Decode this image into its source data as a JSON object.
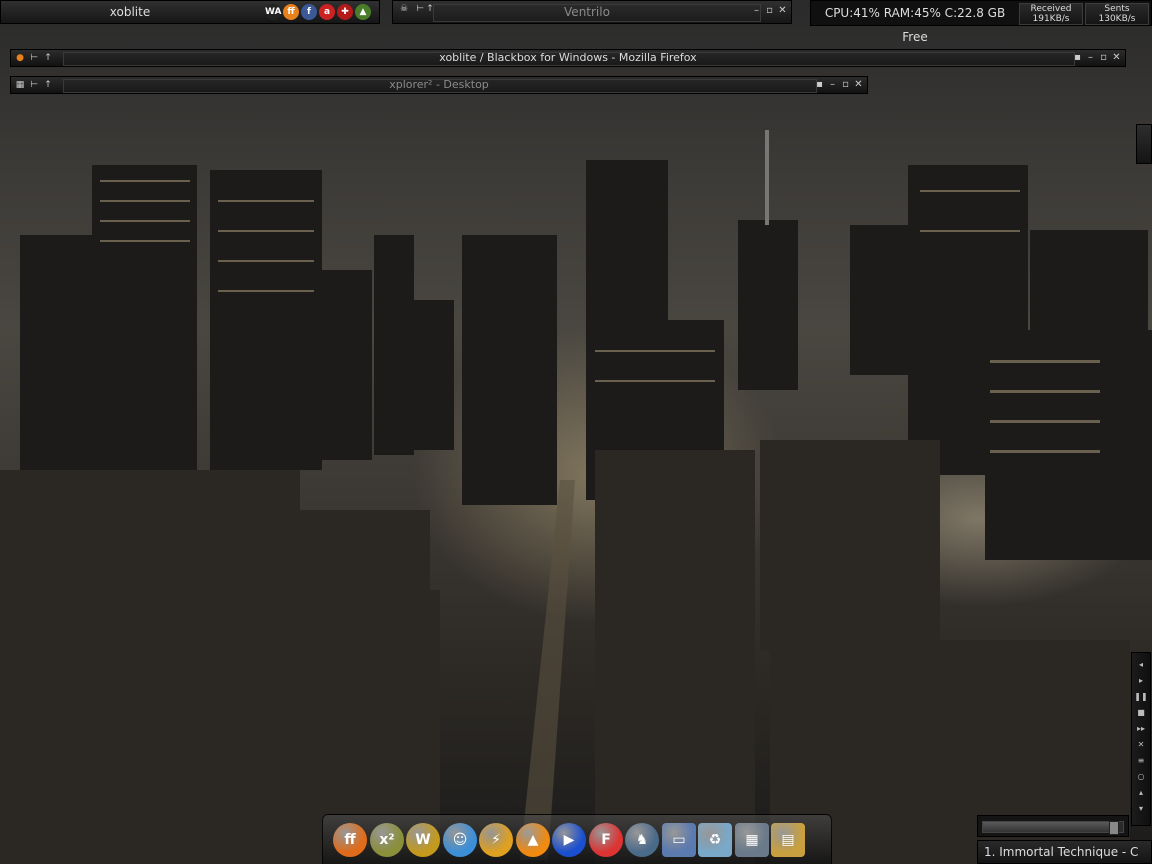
{
  "topbar": {
    "workspace_title": "xoblite",
    "tray_icons": [
      {
        "icon": "winamp-icon",
        "glyph": "WA",
        "color": "#222"
      },
      {
        "icon": "firefox-tray-icon",
        "glyph": "ff",
        "color": "#e8801c"
      },
      {
        "icon": "facebook-icon",
        "glyph": "f",
        "color": "#3b5998"
      },
      {
        "icon": "aim-icon",
        "glyph": "a",
        "color": "#c22"
      },
      {
        "icon": "shield-icon",
        "glyph": "✚",
        "color": "#b31b1b"
      },
      {
        "icon": "network-icon",
        "glyph": "▲",
        "color": "#4a7d2a"
      }
    ],
    "ventrilo_title": "Ventrilo",
    "system_stats": "CPU:41% RAM:45% C:22.8 GB Free",
    "received_label": "Received",
    "received_value": "191KB/s",
    "sent_label": "Sents",
    "sent_value": "130KB/s"
  },
  "windows": {
    "firefox_title": "xoblite / Blackbox for Windows - Mozilla Firefox",
    "xplorer_title": "xplorer² - Desktop"
  },
  "media": {
    "buttons": [
      {
        "icon": "previous-icon",
        "glyph": "◂"
      },
      {
        "icon": "play-icon",
        "glyph": "▸"
      },
      {
        "icon": "pause-icon",
        "glyph": "❚❚"
      },
      {
        "icon": "stop-icon",
        "glyph": "■"
      },
      {
        "icon": "next-icon",
        "glyph": "▸▸"
      },
      {
        "icon": "shuffle-icon",
        "glyph": "✕"
      },
      {
        "icon": "playlist-icon",
        "glyph": "≡"
      },
      {
        "icon": "repeat-icon",
        "glyph": "○"
      },
      {
        "icon": "volume-up-icon",
        "glyph": "▴"
      },
      {
        "icon": "volume-down-icon",
        "glyph": "▾"
      }
    ],
    "seek_fraction": 0.93,
    "now_playing": "1. Immortal Technique - C"
  },
  "dock": {
    "items": [
      {
        "name": "dock-firefox",
        "icon": "firefox-icon",
        "glyph": "ff",
        "color": "#e06b1a"
      },
      {
        "name": "dock-xplorer",
        "icon": "xplorer-icon",
        "glyph": "x²",
        "color": "#8a8f3a"
      },
      {
        "name": "dock-warcraft",
        "icon": "warcraft-icon",
        "glyph": "W",
        "color": "#c49a1c"
      },
      {
        "name": "dock-messenger",
        "icon": "messenger-icon",
        "glyph": "☺",
        "color": "#3b8fd8"
      },
      {
        "name": "dock-winamp",
        "icon": "winamp-dock-icon",
        "glyph": "⚡",
        "color": "#e0a020"
      },
      {
        "name": "dock-vlc",
        "icon": "vlc-icon",
        "glyph": "▲",
        "color": "#f08a10"
      },
      {
        "name": "dock-mediaplayer",
        "icon": "media-player-icon",
        "glyph": "▶",
        "color": "#1a4fd0"
      },
      {
        "name": "dock-filezilla",
        "icon": "filezilla-icon",
        "glyph": "F",
        "color": "#d33"
      },
      {
        "name": "dock-counterstrike",
        "icon": "counter-strike-icon",
        "glyph": "♞",
        "color": "#4a6a8a"
      },
      {
        "name": "dock-folder",
        "icon": "folder-icon",
        "glyph": "▭",
        "color": "#5a7ab0"
      },
      {
        "name": "dock-recycle-bin",
        "icon": "recycle-bin-icon",
        "glyph": "♻",
        "color": "#7aa8c8"
      },
      {
        "name": "dock-desktop",
        "icon": "desktop-icon",
        "glyph": "▦",
        "color": "#6a7a8a"
      },
      {
        "name": "dock-archive",
        "icon": "archive-icon",
        "glyph": "▤",
        "color": "#c8a040"
      }
    ]
  }
}
